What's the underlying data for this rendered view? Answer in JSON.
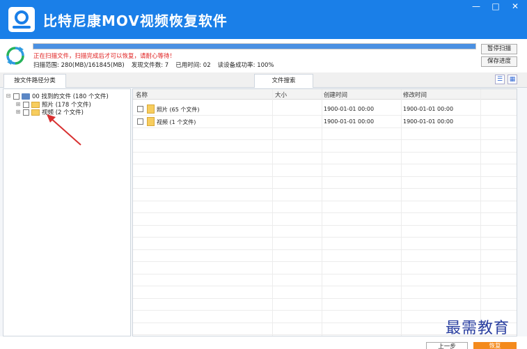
{
  "titlebar": {
    "title": "比特尼康MOV视频恢复软件",
    "minimize_icon": "—",
    "maximize_icon": "□",
    "close_icon": "✕"
  },
  "scan": {
    "progress_percent": 100,
    "warning": "正在扫描文件，扫描完成后才可以恢复，请耐心等待！",
    "range_label": "扫描范围:",
    "range_value": "280(MB)/161845(MB)",
    "found_label": "发现文件数:",
    "found_value": "7",
    "elapsed_label": "已用时间:",
    "elapsed_value": "02",
    "read_label": "读设备成功率:",
    "read_value": "100%",
    "pause_label": "暂停扫描",
    "save_label": "保存进度"
  },
  "tabs": {
    "by_path": "按文件路径分类",
    "search": "文件搜索"
  },
  "tree": {
    "root": "00 找到的文件 (180 个文件)",
    "photos": "照片  (178 个文件)",
    "videos": "视频  (2 个文件)"
  },
  "list": {
    "headers": {
      "name": "名称",
      "size": "大小",
      "created": "创建时间",
      "modified": "修改时间"
    },
    "rows": [
      {
        "name": "照片   (65 个文件)",
        "size": "",
        "created": "1900-01-01 00:00",
        "modified": "1900-01-01 00:00"
      },
      {
        "name": "视频   (1 个文件)",
        "size": "",
        "created": "1900-01-01 00:00",
        "modified": "1900-01-01 00:00"
      }
    ]
  },
  "footer": {
    "next_label": "上一步",
    "recover_label": "恢复",
    "watermark": "最需教育"
  },
  "colors": {
    "titlebar": "#1a7fe8",
    "warning": "#e02020",
    "recover": "#f48a1c"
  }
}
